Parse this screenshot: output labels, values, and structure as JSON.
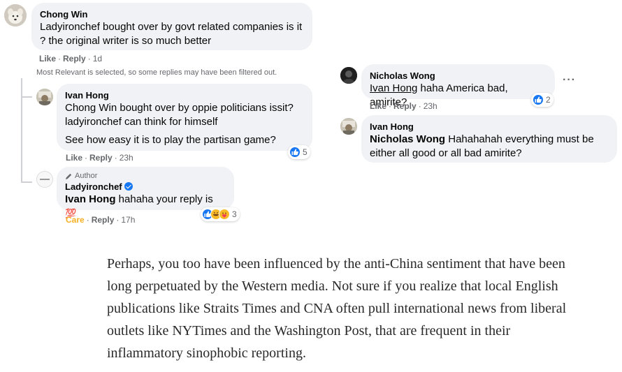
{
  "comments": {
    "chong": {
      "name": "Chong Win",
      "text_line1": "Ladyironchef bought over by govt related companies is it",
      "text_line2": "? the original writer is so much better",
      "like": "Like",
      "reply": "Reply",
      "time": "1d"
    },
    "filtered_notice": "Most Relevant is selected, so some replies may have been filtered out.",
    "ivan1": {
      "name": "Ivan Hong",
      "line1": "Chong Win bought over by oppie politicians issit?",
      "line2": "ladyironchef can think for himself",
      "line3": "See how easy it is to play the partisan game?",
      "like": "Like",
      "reply": "Reply",
      "time": "23h",
      "reaction_count": "5"
    },
    "lady": {
      "author_tag": "Author",
      "name": "Ladyironchef",
      "mention": "Ivan Hong",
      "text": " hahaha your reply is ",
      "emoji": "💯",
      "care": "Care",
      "reply": "Reply",
      "time": "17h",
      "reaction_count": "3"
    },
    "nicholas": {
      "name": "Nicholas Wong",
      "mention": "Ivan Hong",
      "text": " haha America bad, amirite?",
      "like": "Like",
      "reply": "Reply",
      "time": "23h",
      "reaction_count": "2",
      "more": "···"
    },
    "ivan2": {
      "name": "Ivan Hong",
      "mention": "Nicholas Wong",
      "text": " Hahahahah everything must be",
      "text_line2": "either all good or all bad amirite?"
    }
  },
  "article": {
    "paragraph": "Perhaps, you too have been influenced by the anti-China sentiment that have been long perpetuated by the Western media. Not sure if you realize that local English publications like Straits Times and CNA often pull international news from liberal outlets like NYTimes and the Washington Post, that are frequent in their inflammatory sinophobic reporting."
  },
  "colors": {
    "bubble": "#f0f2f5",
    "meta_text": "#65676b",
    "like_blue": "#1877f2",
    "care_yellow": "#f7b125"
  },
  "icons": [
    "dog-avatar",
    "ivan-avatar",
    "ladyironchef-avatar",
    "nicholas-avatar",
    "like-reaction-icon",
    "haha-reaction-icon",
    "care-reaction-icon",
    "verified-badge-icon",
    "pencil-icon",
    "more-options-icon"
  ]
}
